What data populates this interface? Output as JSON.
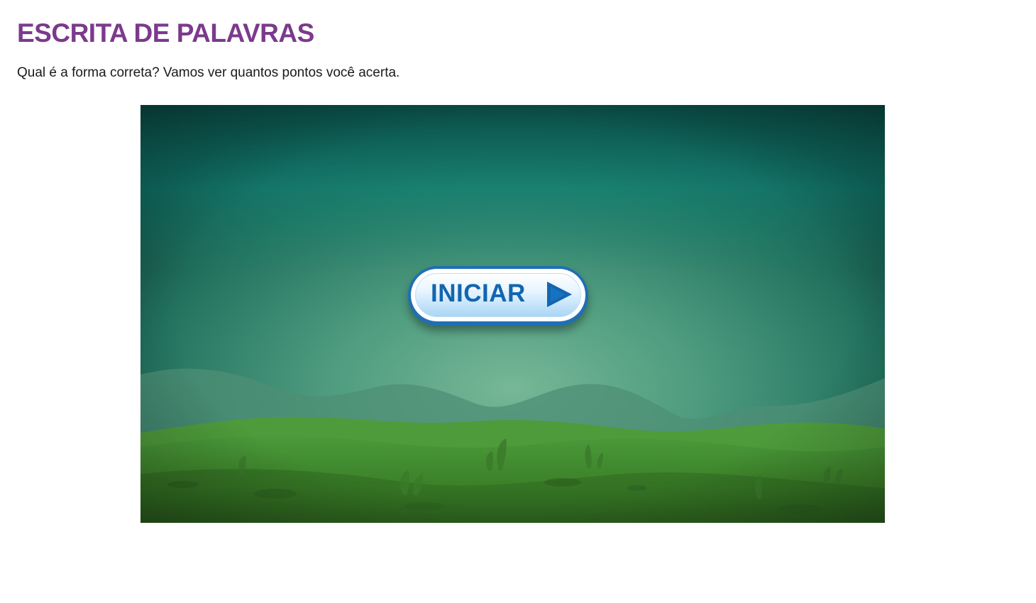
{
  "page": {
    "title": "ESCRITA DE PALAVRAS",
    "subtitle": "Qual é a forma correta? Vamos ver quantos pontos você acerta."
  },
  "game": {
    "start_button_label": "INICIAR",
    "start_button_icon": "play-triangle-icon",
    "colors": {
      "title": "#7b3a8c",
      "sky_top": "#0b4a44",
      "sky_glow": "#6fae8e",
      "grass": "#3f8a2c",
      "button_border": "#1f6fb5",
      "button_text": "#1266b0"
    }
  }
}
